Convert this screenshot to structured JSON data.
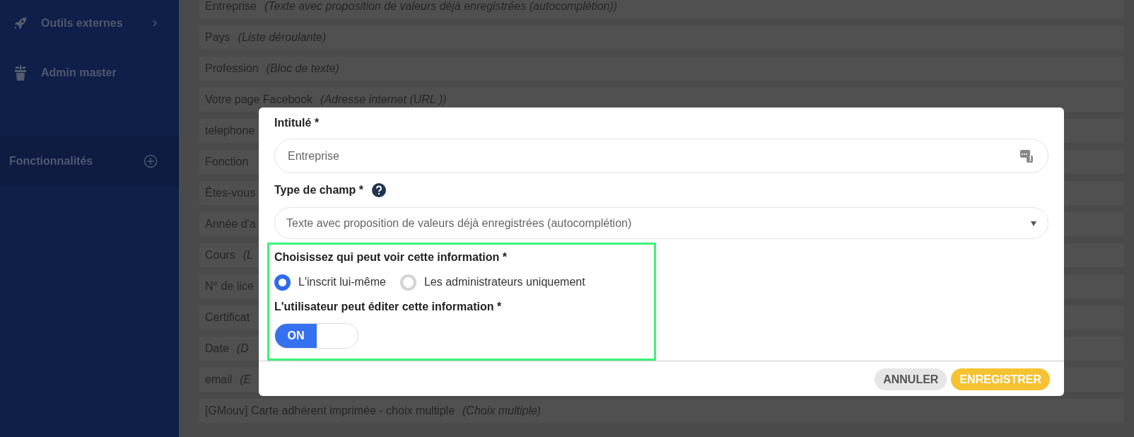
{
  "sidebar": {
    "items": [
      {
        "label": "Outils externes",
        "kind": "link",
        "has_submenu": true
      },
      {
        "label": "Admin master",
        "kind": "link",
        "has_submenu": false
      },
      {
        "label": "Fonctionnalités",
        "kind": "section",
        "has_submenu": false
      }
    ]
  },
  "fields_list": [
    {
      "name": "Entreprise",
      "type": "(Texte avec proposition de valeurs déjà enregistrées (autocomplétion))"
    },
    {
      "name": "Pays",
      "type": "(Liste déroulante)"
    },
    {
      "name": "Profession",
      "type": "(Bloc de texte)"
    },
    {
      "name": "Votre page Facebook",
      "type": "(Adresse internet (URL ))"
    },
    {
      "name": "telephone"
    },
    {
      "name": "Fonction"
    },
    {
      "name": "Êtes-vous"
    },
    {
      "name": "Année d'a"
    },
    {
      "name": "Cours",
      "type": "(L"
    },
    {
      "name": "N° de lice"
    },
    {
      "name": "Certificat"
    },
    {
      "name": "Date",
      "type": "(D"
    },
    {
      "name": "email",
      "type": "(E"
    },
    {
      "name": "[GMouv] Carte adhérent imprimée - choix multiple",
      "type": "(Choix multiple)"
    }
  ],
  "modal": {
    "title_label": "Intitulé *",
    "title_value": "Entreprise",
    "type_label": "Type de champ *",
    "type_value": "Texte avec proposition de valeurs déjà enregistrées (autocomplétion)",
    "visibility_label": "Choisissez qui peut voir cette information *",
    "visibility_options": [
      {
        "label": "L'inscrit lui-même",
        "selected": true
      },
      {
        "label": "Les administrateurs uniquement",
        "selected": false
      }
    ],
    "edit_label": "L'utilisateur peut éditer cette information *",
    "edit_toggle": {
      "label": "ON",
      "on": true
    },
    "buttons": [
      {
        "label": "ANNULER",
        "kind": "secondary"
      },
      {
        "label": "ENREGISTRER",
        "kind": "primary"
      }
    ]
  }
}
